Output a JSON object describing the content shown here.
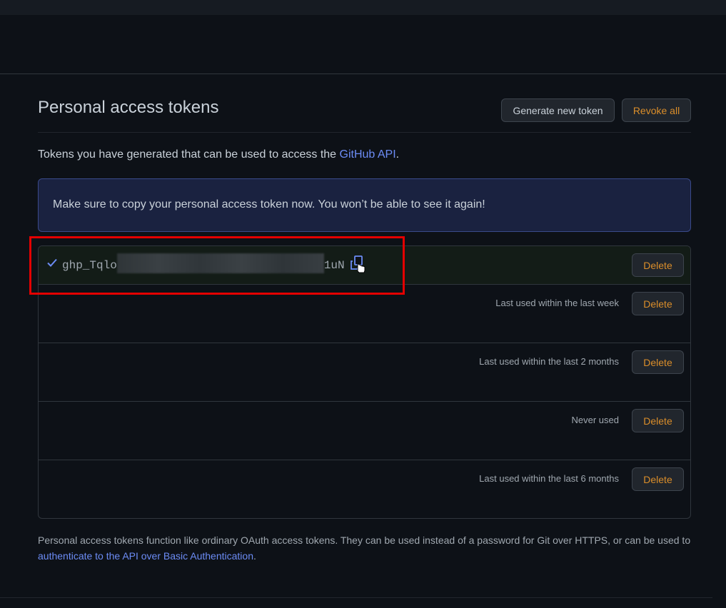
{
  "page": {
    "title": "Personal access tokens",
    "generate_button": "Generate new token",
    "revoke_all_button": "Revoke all",
    "intro_prefix": "Tokens you have generated that can be used to access the ",
    "intro_link": "GitHub API",
    "intro_suffix": "."
  },
  "flash": {
    "message": "Make sure to copy your personal access token now. You won’t be able to see it again!"
  },
  "new_token": {
    "prefix": "ghp_Tqlo",
    "suffix": "1uN",
    "delete_label": "Delete"
  },
  "tokens": [
    {
      "usage": "Last used within the last week",
      "delete_label": "Delete"
    },
    {
      "usage": "Last used within the last 2 months",
      "delete_label": "Delete"
    },
    {
      "usage": "Never used",
      "delete_label": "Delete"
    },
    {
      "usage": "Last used within the last 6 months",
      "delete_label": "Delete"
    }
  ],
  "footer": {
    "text": "Personal access tokens function like ordinary OAuth access tokens. They can be used instead of a password for Git over HTTPS, or can be used to ",
    "link": "authenticate to the API over Basic Authentication",
    "suffix": "."
  },
  "icons": {
    "check": "check-icon",
    "copy": "copy-icon",
    "cursor": "hand-pointer-icon"
  },
  "colors": {
    "background": "#0d1117",
    "link": "#6c8cf5",
    "danger_text": "#db8e2a",
    "highlight": "#e30000",
    "flash_bg": "#1a2240",
    "success_row_bg": "#131c17"
  }
}
